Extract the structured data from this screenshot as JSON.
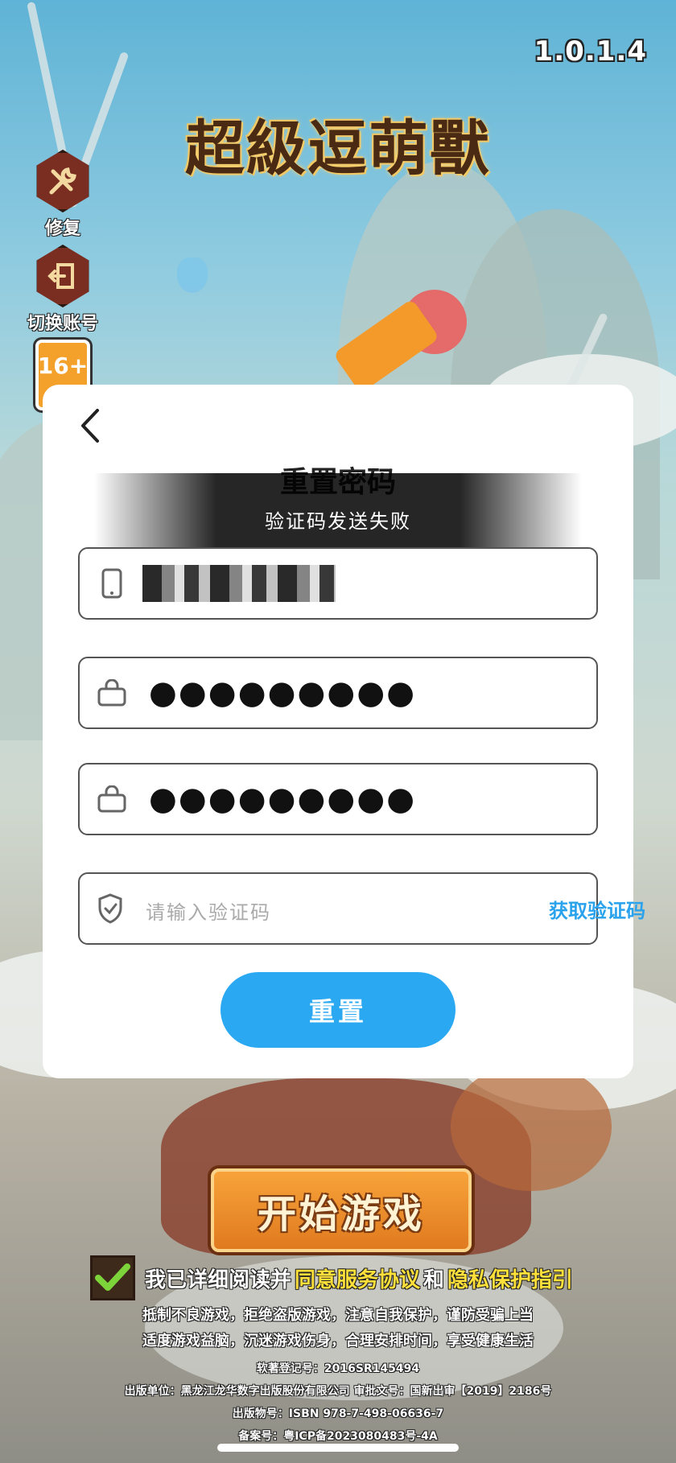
{
  "version": "1.0.1.4",
  "logo": {
    "text": "超級逗萌獸"
  },
  "side_buttons": {
    "repair": {
      "label": "修复",
      "icon": "wrench-hammer-icon"
    },
    "switch_account": {
      "label": "切换账号",
      "icon": "exit-door-icon"
    }
  },
  "age_badge": "16+",
  "modal": {
    "back_icon": "chevron-left-icon",
    "title": "重置密码",
    "toast": "验证码发送失败",
    "phone_field": {
      "icon": "phone-icon",
      "value": ""
    },
    "password_field": {
      "icon": "lock-icon",
      "value": "●●●●●●●●●"
    },
    "confirm_field": {
      "icon": "lock-icon",
      "value": "●●●●●●●●●"
    },
    "code_field": {
      "icon": "shield-check-icon",
      "placeholder": "请输入验证码",
      "get_code_label": "获取验证码"
    },
    "reset_label": "重置"
  },
  "start_button": {
    "label": "开始游戏"
  },
  "agreement": {
    "prefix": "我已详细阅读并",
    "service_link": "同意服务协议",
    "and": "和",
    "privacy_link": "隐私保护指引"
  },
  "notices": {
    "line1": "抵制不良游戏，拒绝盗版游戏，注意自我保护，谨防受骗上当",
    "line2": "适度游戏益脑，沉迷游戏伤身，合理安排时间，享受健康生活",
    "line3": "软著登记号：2016SR145494",
    "line4": "出版单位：黑龙江龙华数字出版股份有限公司 审批文号：国新出审【2019】2186号",
    "line5": "出版物号：ISBN 978-7-498-06636-7",
    "line6": "备案号：粤ICP备2023080483号-4A"
  },
  "colors": {
    "accent_blue": "#2aa8f2",
    "link_yellow": "#ffe03a",
    "start_orange": "#e07a1f"
  }
}
